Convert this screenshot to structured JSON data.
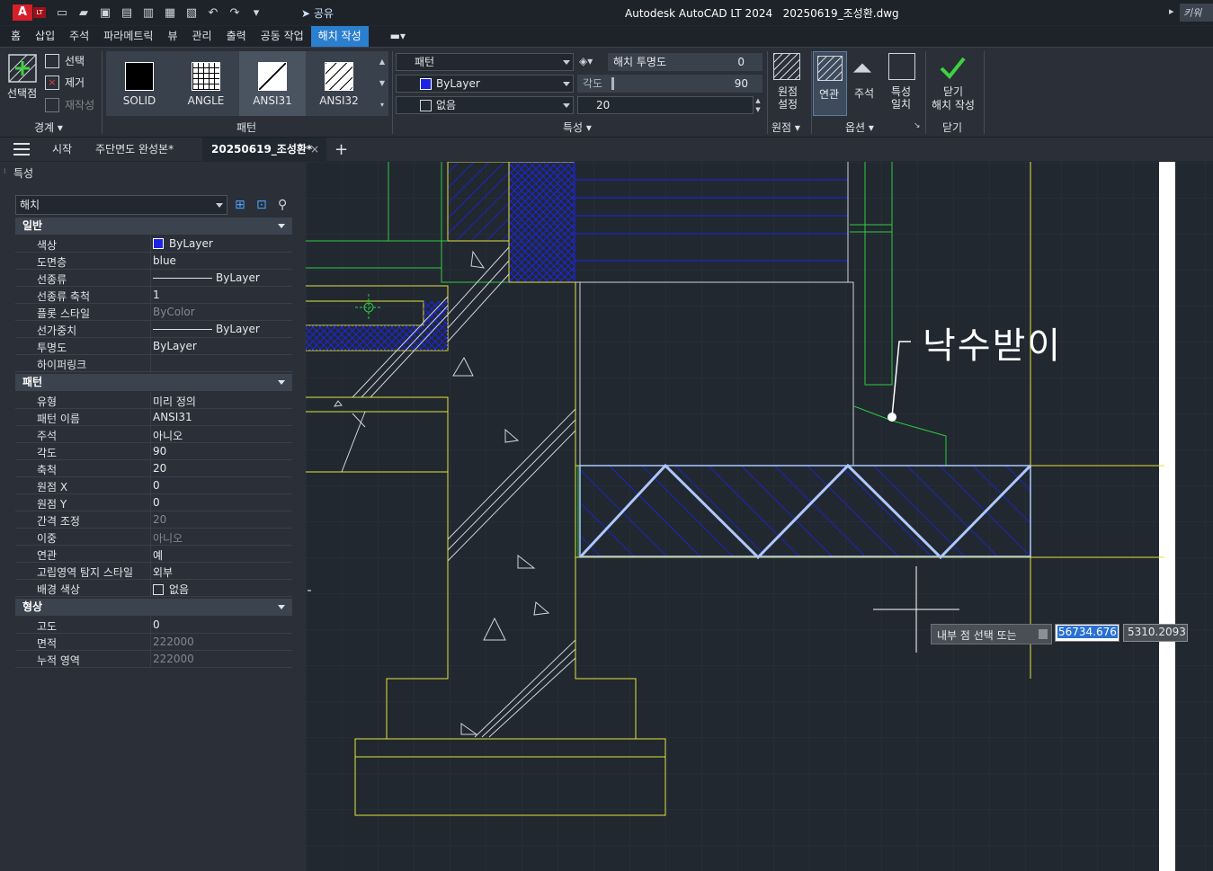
{
  "titlebar": {
    "app": "Autodesk AutoCAD LT 2024",
    "file": "20250619_조성환.dwg",
    "share": "공유",
    "keyword": "키워드"
  },
  "menu": [
    "홈",
    "삽입",
    "주석",
    "파라메트릭",
    "뷰",
    "관리",
    "출력",
    "공동 작업",
    "해치 작성"
  ],
  "ribbon": {
    "boundary": {
      "pick_point": "선택점",
      "select": "선택",
      "remove": "제거",
      "recreate": "재작성",
      "panel": "경계"
    },
    "pattern": {
      "items": [
        "SOLID",
        "ANGLE",
        "ANSI31",
        "ANSI32"
      ],
      "panel": "패턴"
    },
    "properties": {
      "type": "패턴",
      "color": "ByLayer",
      "bg": "없음",
      "transparency_label": "해치 투명도",
      "transparency_value": "0",
      "angle_label": "각도",
      "angle_value": "90",
      "scale_value": "20",
      "panel": "특성"
    },
    "origin": {
      "set_line1": "원점",
      "set_line2": "설정",
      "panel": "원점"
    },
    "options": {
      "assoc": "연관",
      "annotative": "주석",
      "match_line1": "특성",
      "match_line2": "일치",
      "panel": "옵션"
    },
    "close": {
      "line1": "닫기",
      "line2": "해치 작성",
      "panel": "닫기"
    }
  },
  "doc_tabs": {
    "start": "시작",
    "tab1": "주단면도 완성본*",
    "tab2": "20250619_조성환*"
  },
  "props": {
    "title": "특성",
    "selector": "해치",
    "general": {
      "title": "일반",
      "rows": [
        {
          "k": "색상",
          "v": "ByLayer"
        },
        {
          "k": "도면층",
          "v": "blue"
        },
        {
          "k": "선종류",
          "v": "ByLayer"
        },
        {
          "k": "선종류 축척",
          "v": "1"
        },
        {
          "k": "플롯 스타일",
          "v": "ByColor"
        },
        {
          "k": "선가중치",
          "v": "ByLayer"
        },
        {
          "k": "투명도",
          "v": "ByLayer"
        },
        {
          "k": "하이퍼링크",
          "v": ""
        }
      ]
    },
    "pattern": {
      "title": "패턴",
      "rows": [
        {
          "k": "유형",
          "v": "미리 정의"
        },
        {
          "k": "패턴 이름",
          "v": "ANSI31"
        },
        {
          "k": "주석",
          "v": "아니오"
        },
        {
          "k": "각도",
          "v": "90"
        },
        {
          "k": "축척",
          "v": "20"
        },
        {
          "k": "원점 X",
          "v": "0"
        },
        {
          "k": "원점 Y",
          "v": "0"
        },
        {
          "k": "간격 조정",
          "v": "20"
        },
        {
          "k": "이중",
          "v": "아니오"
        },
        {
          "k": "연관",
          "v": "예"
        },
        {
          "k": "고립영역 탐지 스타일",
          "v": "외부"
        },
        {
          "k": "배경 색상",
          "v": "없음"
        }
      ]
    },
    "geometry": {
      "title": "형상",
      "rows": [
        {
          "k": "고도",
          "v": "0"
        },
        {
          "k": "면적",
          "v": "222000"
        },
        {
          "k": "누적 영역",
          "v": "222000"
        }
      ]
    }
  },
  "canvas": {
    "label": "낙수받이",
    "prompt": "내부 점 선택 또는",
    "input_x": "56734.676",
    "input_y": "5310.2093"
  },
  "colors": {
    "accent": "#2b7fcf",
    "yellow": "#e5e53a",
    "green": "#2ecc40",
    "blue": "#1b24e6"
  }
}
